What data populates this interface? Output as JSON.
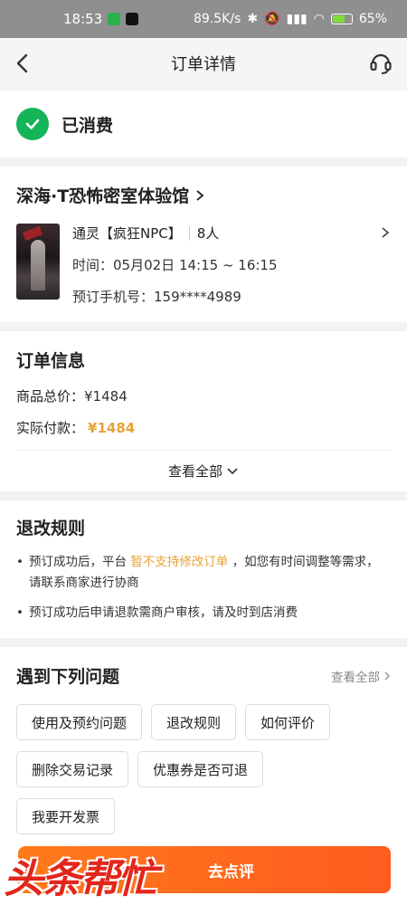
{
  "statusbar": {
    "time": "18:53",
    "network_speed": "89.5K/s",
    "battery": "65%"
  },
  "header": {
    "title": "订单详情"
  },
  "status": {
    "label": "已消费"
  },
  "shop": {
    "name": "深海·T恐怖密室体验馆",
    "item_title": "通灵【疯狂NPC】",
    "people": "8人",
    "time_line": "时间：05月02日 14:15 ~ 16:15",
    "phone_line": "预订手机号：159****4989"
  },
  "order": {
    "title": "订单信息",
    "total_label": "商品总价：",
    "total_value": "¥1484",
    "paid_label": "实际付款：",
    "paid_value": "¥1484",
    "view_all": "查看全部"
  },
  "rules": {
    "title": "退改规则",
    "r1_pre": "预订成功后，平台",
    "r1_hl": "暂不支持修改订单",
    "r1_post": "，如您有时间调整等需求，请联系商家进行协商",
    "r2": "预订成功后申请退款需商户审核，请及时到店消费"
  },
  "faq": {
    "title": "遇到下列问题",
    "view_all": "查看全部",
    "tags": [
      "使用及预约问题",
      "退改规则",
      "如何评价",
      "删除交易记录",
      "优惠券是否可退",
      "我要开发票"
    ]
  },
  "bottom": {
    "watermark": "头条帮忙",
    "review_button": "去点评"
  },
  "colors": {
    "accent": "#e8a23a",
    "success": "#16b458",
    "cta": "#ff6a1d"
  }
}
